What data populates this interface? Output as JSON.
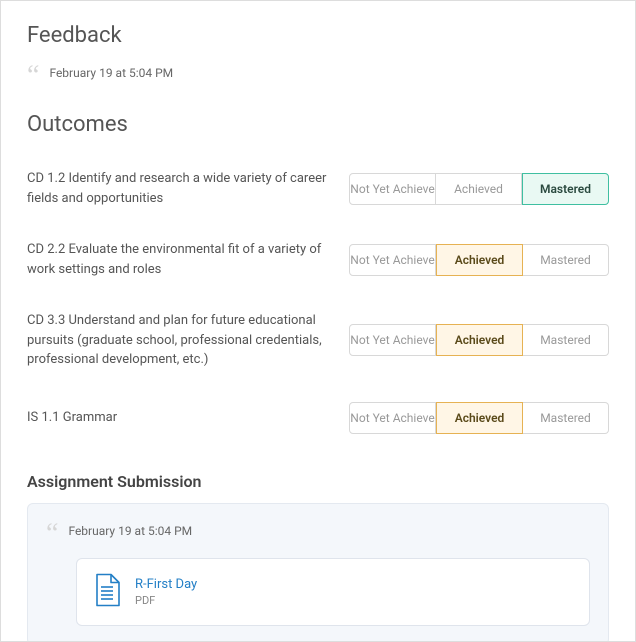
{
  "feedback": {
    "heading": "Feedback",
    "timestamp": "February 19 at 5:04 PM"
  },
  "outcomes": {
    "heading": "Outcomes",
    "level_labels": {
      "not_yet": "Not Yet Achieve",
      "achieved": "Achieved",
      "mastered": "Mastered"
    },
    "items": [
      {
        "label": "CD 1.2 Identify and research a wide variety of career fields and opportunities",
        "selected": "mastered"
      },
      {
        "label": "CD 2.2 Evaluate the environmental fit of a variety of work settings and roles",
        "selected": "achieved"
      },
      {
        "label": "CD 3.3 Understand and plan for future educational pursuits (graduate school, professional credentials, professional development, etc.)",
        "selected": "achieved"
      },
      {
        "label": "IS 1.1 Grammar",
        "selected": "achieved"
      }
    ]
  },
  "submission": {
    "heading": "Assignment Submission",
    "timestamp": "February 19 at 5:04 PM",
    "file": {
      "name": "R-First Day",
      "type_label": "PDF"
    }
  }
}
